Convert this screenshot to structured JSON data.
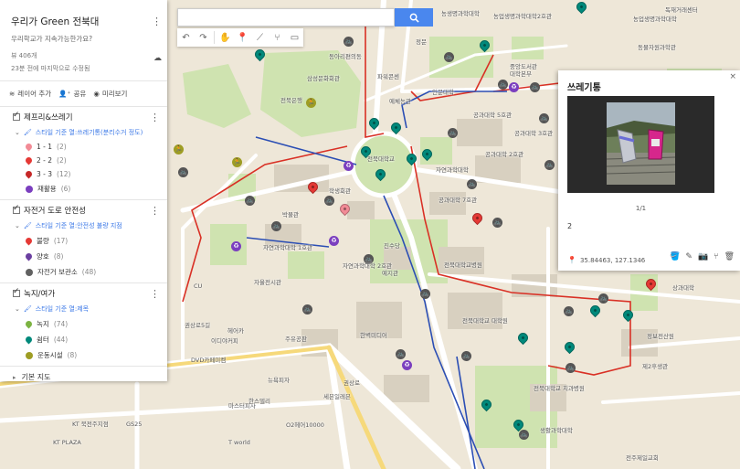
{
  "header": {
    "title": "우리가 Green 전북대",
    "description": "우리학교가 지속가능한가요?",
    "views": "뷰 406개",
    "updated": "23분 전에 마지막으로 수정됨"
  },
  "actions": {
    "add_layer": "레이어 추가",
    "share": "공유",
    "preview": "미리보기"
  },
  "layers": [
    {
      "name": "제프리&쓰레기",
      "style": "스타일 기준 열:쓰레기통(분리수거 정도)",
      "items": [
        {
          "label": "1 - 1",
          "count": "(2)",
          "color": "#f28b96",
          "icon": "pin"
        },
        {
          "label": "2 - 2",
          "count": "(2)",
          "color": "#e53935",
          "icon": "pin"
        },
        {
          "label": "3 - 3",
          "count": "(12)",
          "color": "#c62828",
          "icon": "pin"
        },
        {
          "label": "재활용",
          "count": "(6)",
          "color": "#7b3fbf",
          "icon": "recycle"
        }
      ]
    },
    {
      "name": "자전거 도로 안전성",
      "style": "스타일 기준 열:안전성 불량 지점",
      "items": [
        {
          "label": "불량",
          "count": "(17)",
          "color": "#e53935",
          "icon": "pin"
        },
        {
          "label": "양호",
          "count": "(8)",
          "color": "#6a3fa0",
          "icon": "pin"
        },
        {
          "label": "자전거 보관소",
          "count": "(48)",
          "color": "#616161",
          "icon": "bike"
        }
      ]
    },
    {
      "name": "녹지/여가",
      "style": "스타일 기준 열:제목",
      "items": [
        {
          "label": "녹지",
          "count": "(74)",
          "color": "#7cb342",
          "icon": "pin"
        },
        {
          "label": "쉼터",
          "count": "(44)",
          "color": "#00897b",
          "icon": "pin"
        },
        {
          "label": "운동시설",
          "count": "(8)",
          "color": "#9e9d24",
          "icon": "runner"
        }
      ]
    }
  ],
  "base_map": "기본 지도",
  "card": {
    "title": "쓰레기통",
    "close": "×",
    "counter": "1/1",
    "description": "2",
    "coords": "35.84463, 127.1346"
  },
  "map_labels": [
    "농생명과학대학",
    "농업생명과학대학2호관",
    "동물자원과학관",
    "독재거래센터",
    "농업생명과학대학",
    "삼성문화회관",
    "전북은행",
    "동아리편의동",
    "파워콘센",
    "예체능관",
    "정문",
    "중앙도서관",
    "대학본부",
    "인문대학",
    "공과대학 5호관",
    "공과대학 2호관",
    "공과대학 3호관",
    "자연과학대학",
    "공과대학 7호관",
    "전북대학교",
    "박물관",
    "학생회관",
    "자연과학대학 1호관",
    "자연과학대학 2호관",
    "예지관",
    "자율전시관",
    "전북대학교병원",
    "전북대학교 대학원",
    "한벽미디어",
    "진수당",
    "상과대학",
    "정보전산원",
    "제2후생관",
    "전북대학교 치과병원",
    "생활과학대학",
    "마스터피자",
    "KT 북전주지점",
    "KT PLAZA",
    "GS25",
    "CU",
    "한스델리",
    "세븐일레븐",
    "T world",
    "O2헤어10000",
    "뉴욕피자",
    "헤어카",
    "주유공판",
    "DVD카페미켐",
    "이디야커피",
    "권상로5길",
    "권상로",
    "전주제일교회"
  ]
}
